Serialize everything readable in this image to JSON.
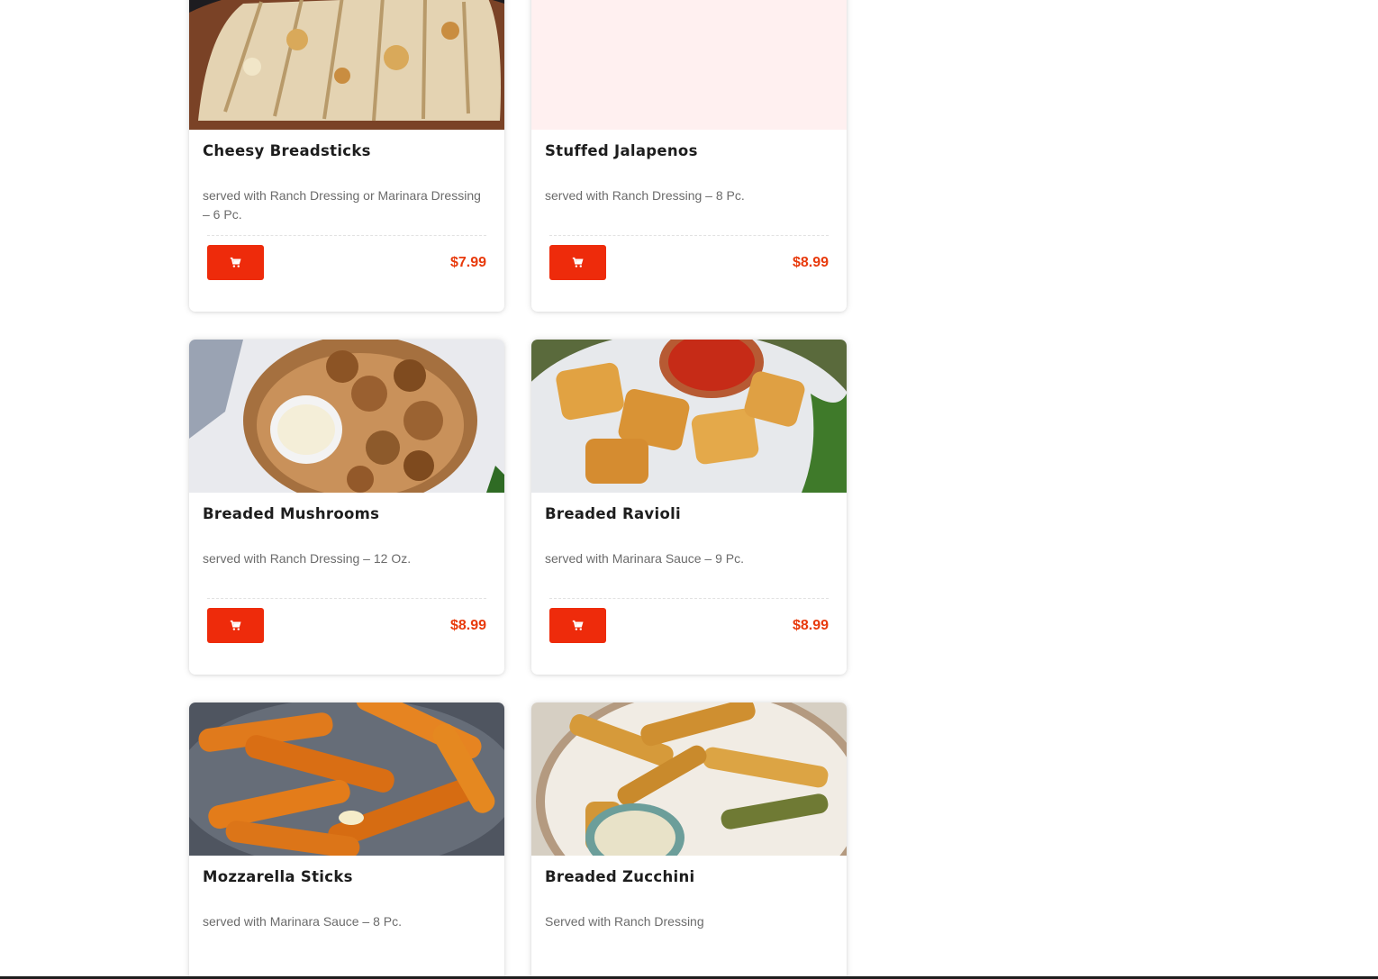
{
  "theme": {
    "accent": "#ee2b0b",
    "price_color": "#e83a0c",
    "title_color": "#1d1d1d",
    "desc_color": "#6b6b6b",
    "placeholder_bg": "#fff0f0"
  },
  "menu": {
    "cart_icon": "cart-icon",
    "items": [
      {
        "title": "Cheesy Breadsticks",
        "description": "served with Ranch Dressing or Marinara Dressing – 6 Pc.",
        "price": "$7.99",
        "image": "breadsticks"
      },
      {
        "title": "Stuffed Jalapenos",
        "description": "served with Ranch Dressing – 8 Pc.",
        "price": "$8.99",
        "image": "none"
      },
      {
        "title": "Breaded Mushrooms",
        "description": "served with Ranch Dressing – 12 Oz.",
        "price": "$8.99",
        "image": "mushrooms"
      },
      {
        "title": "Breaded Ravioli",
        "description": "served with Marinara Sauce – 9 Pc.",
        "price": "$8.99",
        "image": "ravioli"
      },
      {
        "title": "Mozzarella Sticks",
        "description": "served with Marinara Sauce – 8 Pc.",
        "price": "",
        "image": "mozzarella-sticks"
      },
      {
        "title": "Breaded Zucchini",
        "description": "Served with Ranch Dressing",
        "price": "",
        "image": "zucchini"
      }
    ]
  }
}
